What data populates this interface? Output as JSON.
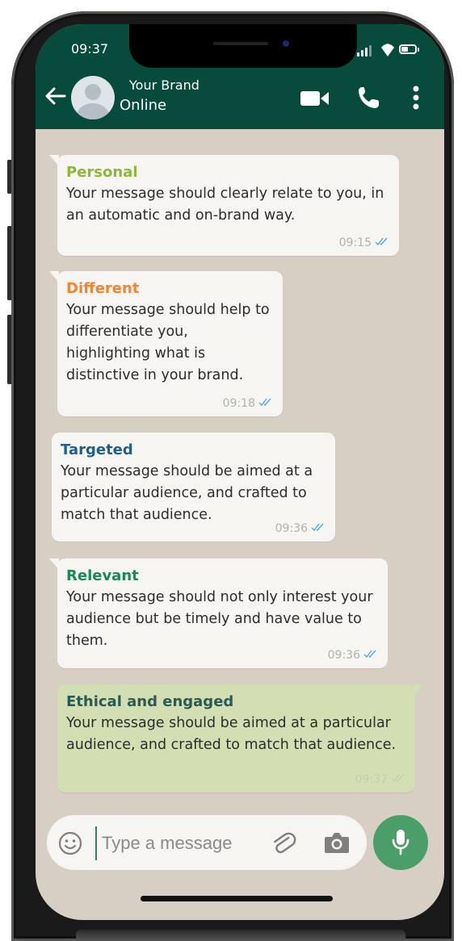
{
  "status_bar": {
    "time": "09:37"
  },
  "header": {
    "contact_name": "Your Brand",
    "presence": "Online"
  },
  "messages": [
    {
      "title": "Personal",
      "title_color": "#8cb73a",
      "text": "Your message should clearly relate to you, in an automatic and on-brand way.",
      "time": "09:15",
      "direction": "incoming"
    },
    {
      "title": "Different",
      "title_color": "#f08632",
      "text": "Your message should help to differentiate you, highlighting what is distinctive in your brand.",
      "time": "09:18",
      "direction": "incoming"
    },
    {
      "title": "Targeted",
      "title_color": "#1f5e8e",
      "text": "Your message should be aimed at a particular audience, and crafted to match that audience.",
      "time": "09:36",
      "direction": "incoming"
    },
    {
      "title": "Relevant",
      "title_color": "#178a55",
      "text": "Your message should not only interest your audience but be timely and have value to them.",
      "time": "09:36",
      "direction": "incoming"
    },
    {
      "title": "Ethical and engaged",
      "title_color": "#2b5a55",
      "text": "Your message should be aimed at a particular audience, and crafted to match that audience.",
      "time": "09:37",
      "direction": "outgoing"
    }
  ],
  "composer": {
    "placeholder": "Type a message"
  },
  "colors": {
    "header_bg": "#064b3b",
    "chat_bg": "#d8cfc4",
    "outgoing_bubble": "#d1dfb3",
    "read_tick": "#53a6e6",
    "send_button": "#4a9e68"
  },
  "icons": [
    "back-arrow-icon",
    "avatar-icon",
    "video-call-icon",
    "phone-icon",
    "more-options-icon",
    "emoji-icon",
    "attach-icon",
    "camera-icon",
    "mic-icon",
    "double-check-icon",
    "signal-icon",
    "wifi-icon",
    "battery-icon"
  ]
}
